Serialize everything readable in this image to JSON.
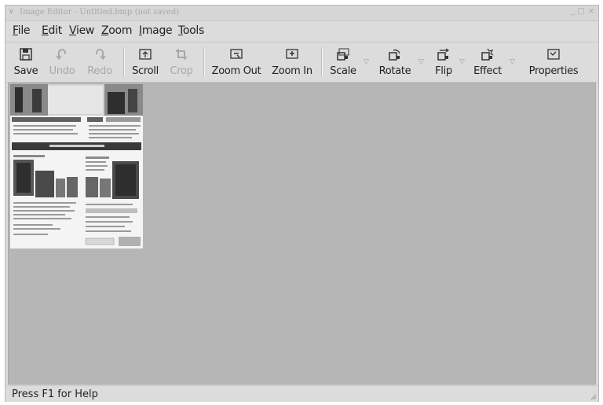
{
  "window": {
    "title": "Image Editor - Untitled.bmp (not saved)",
    "menu_glyph": "∨",
    "controls": [
      "_",
      "□",
      "×"
    ]
  },
  "menu": {
    "items": [
      {
        "first": "F",
        "rest": "ile"
      },
      {
        "first": "E",
        "rest": "dit"
      },
      {
        "first": "V",
        "rest": "iew"
      },
      {
        "first": "Z",
        "rest": "oom"
      },
      {
        "first": "I",
        "rest": "mage"
      },
      {
        "first": "T",
        "rest": "ools"
      }
    ]
  },
  "toolbar": {
    "save": {
      "label": "Save",
      "icon": "floppy-disk-icon"
    },
    "undo": {
      "label": "Undo",
      "icon": "undo-icon",
      "enabled": false
    },
    "redo": {
      "label": "Redo",
      "icon": "redo-icon",
      "enabled": false
    },
    "scroll": {
      "label": "Scroll",
      "icon": "scroll-icon"
    },
    "crop": {
      "label": "Crop",
      "icon": "crop-icon",
      "enabled": false
    },
    "zoom_out": {
      "label": "Zoom Out",
      "icon": "zoom-out-icon"
    },
    "zoom_in": {
      "label": "Zoom In",
      "icon": "zoom-in-icon"
    },
    "scale": {
      "label": "Scale",
      "icon": "scale-icon"
    },
    "rotate": {
      "label": "Rotate",
      "icon": "rotate-icon"
    },
    "flip": {
      "label": "Flip",
      "icon": "flip-icon"
    },
    "effect": {
      "label": "Effect",
      "icon": "effect-icon"
    },
    "properties": {
      "label": "Properties",
      "icon": "properties-icon"
    },
    "dropdown_glyph": "▽"
  },
  "status": {
    "text": "Press F1 for Help"
  },
  "colors": {
    "canvas": "#b6b6b6",
    "chrome": "#dcdcdc"
  }
}
